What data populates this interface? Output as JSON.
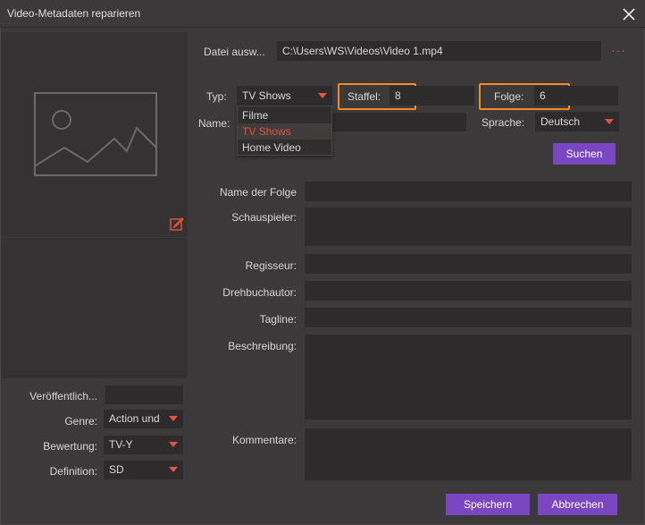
{
  "window": {
    "title": "Video-Metadaten reparieren"
  },
  "file": {
    "label": "Datei ausw...",
    "path": "C:\\Users\\WS\\Videos\\Video 1.mp4",
    "more": "···"
  },
  "typ": {
    "label": "Typ:",
    "value": "TV Shows",
    "options": [
      "Filme",
      "TV Shows",
      "Home Video"
    ]
  },
  "staffel": {
    "label": "Staffel:",
    "value": "8"
  },
  "folge": {
    "label": "Folge:",
    "value": "6"
  },
  "name": {
    "label": "Name:",
    "value": ""
  },
  "sprache": {
    "label": "Sprache:",
    "value": "Deutsch"
  },
  "search_button": "Suchen",
  "details": {
    "episode_name": "Name der Folge",
    "actors": "Schauspieler:",
    "director": "Regisseur:",
    "writer": "Drehbuchautor:",
    "tagline": "Tagline:",
    "description": "Beschreibung:",
    "comments": "Kommentare:"
  },
  "left": {
    "release_label": "Veröffentlich...",
    "release_value": "",
    "genre_label": "Genre:",
    "genre_value": "Action und",
    "rating_label": "Bewertung:",
    "rating_value": "TV-Y",
    "definition_label": "Definition:",
    "definition_value": "SD"
  },
  "footer": {
    "save": "Speichern",
    "cancel": "Abbrechen"
  },
  "colors": {
    "accent": "#7b46c2",
    "highlight": "#f08a25",
    "arrow": "#e4543f"
  },
  "icons": {
    "close": "close-icon",
    "cover": "image-placeholder-icon",
    "edit": "edit-icon"
  }
}
